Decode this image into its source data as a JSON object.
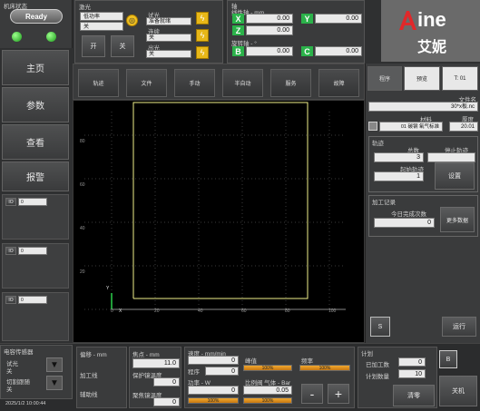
{
  "machine_status": {
    "title": "机床状态",
    "state": "Ready"
  },
  "menu": [
    "主页",
    "参数",
    "查看",
    "报警"
  ],
  "left_slots": [
    {
      "label": "IO",
      "value": "0"
    },
    {
      "label": "IO",
      "value": "0"
    },
    {
      "label": "IO",
      "value": "0"
    }
  ],
  "laser": {
    "title": "激光",
    "mode_label": "低功率",
    "mode_value": "关",
    "on_label": "开",
    "off_label": "关",
    "items": [
      {
        "label": "试光",
        "value": "准备就绪"
      },
      {
        "label": "连续",
        "value": "关"
      },
      {
        "label": "出光",
        "value": "关"
      }
    ]
  },
  "axes": {
    "title": "轴",
    "linear_label": "线性轴 - mm",
    "rotary_label": "旋转轴 - °",
    "list": [
      {
        "name": "X",
        "value": "0.00"
      },
      {
        "name": "Y",
        "value": "0.00"
      },
      {
        "name": "Z",
        "value": "0.00"
      },
      {
        "name": "B",
        "value": "0.00"
      },
      {
        "name": "C",
        "value": "0.00"
      }
    ]
  },
  "brand": {
    "name": "ine",
    "cn": "艾妮",
    "accent": "#e0282a"
  },
  "toolbar": [
    "轨迹",
    "文件",
    "手动",
    "半自动",
    "服务",
    "故障"
  ],
  "canvas": {
    "y_ticks": [
      "80",
      "60",
      "40",
      "20"
    ],
    "x_ticks": [
      "0",
      "20",
      "40",
      "60",
      "80",
      "100"
    ],
    "x_axis": "X",
    "y_axis": "Y"
  },
  "chart_data": {
    "type": "line",
    "title": "",
    "xlabel": "X",
    "ylabel": "Y",
    "xlim": [
      0,
      100
    ],
    "ylim": [
      0,
      100
    ],
    "series": [
      {
        "x": [
          10,
          10,
          90,
          90,
          10
        ],
        "y": [
          5,
          95,
          95,
          5,
          5
        ]
      }
    ]
  },
  "right_tabs": [
    "程序",
    "预览",
    "T: 01"
  ],
  "program": {
    "file_label": "文件名",
    "file_name": "30*x板.nc",
    "material_label": "材料",
    "material_value": "01 碳钢 氧气标准",
    "thickness_label": "厚度",
    "thickness_value": "20.01",
    "trace_title": "轨迹",
    "total_label": "总数",
    "total_value": "3",
    "stop_label": "停止轨迹",
    "stop_value": "",
    "start_label": "起始轨迹",
    "start_value": "1",
    "reset_label": "设置",
    "record_title": "加工记录",
    "today_label": "今日完成次数",
    "today_value": "0",
    "clear_label": "更多数据",
    "s_label": "S",
    "run_label": "运行"
  },
  "sensor": {
    "title": "电容传感器",
    "items": [
      {
        "label": "试光",
        "value": "关"
      },
      {
        "label": "切割跟随",
        "value": "关"
      }
    ]
  },
  "datetime": "2025/1/2 10:00:44",
  "offset": {
    "title": "偏移 - mm",
    "row1": "加工线",
    "row2": "辅助线"
  },
  "focus": {
    "title": "焦点 - mm",
    "value": "11.0",
    "protect_label": "保护镜温度",
    "protect_value": "0",
    "nozzle_label": "聚焦镜温度",
    "nozzle_value": "0"
  },
  "speed": {
    "title": "速度 - mm/min",
    "value": "0",
    "program_label": "程序",
    "program_value": "0",
    "power_label": "功率 - W",
    "power_value": "0",
    "pct": "100%",
    "peak_label": "峰值",
    "peak_pct": "100%",
    "freq_label": "频率",
    "freq_pct": "100%",
    "gas_label": "比例阀 气体 - Bar",
    "gas_value": "0.05",
    "gas_pct": "100%",
    "minus": "-",
    "plus": "+"
  },
  "plan": {
    "title": "计划",
    "done_label": "已加工数",
    "done_value": "0",
    "plan_label": "计划数量",
    "plan_value": "10",
    "b_label": "B",
    "clear_label": "清零",
    "close_label": "关机"
  }
}
